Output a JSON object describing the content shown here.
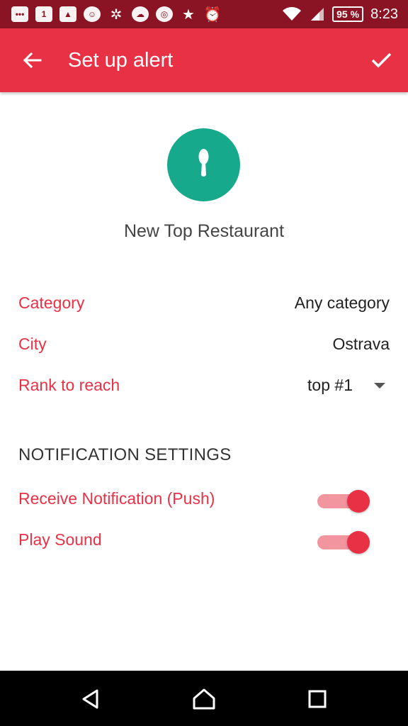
{
  "status_bar": {
    "notification_icons": [
      "messages-icon",
      "calendar-icon",
      "gallery-icon",
      "app-icon",
      "butterfly-icon",
      "weather-icon",
      "app2-icon",
      "star-icon",
      "alarm-icon"
    ],
    "calendar_number": "1",
    "battery": "95 %",
    "time": "8:23"
  },
  "app_bar": {
    "title": "Set up alert"
  },
  "alert": {
    "name": "New Top Restaurant",
    "badge_color": "#16a98c",
    "icon": "spoon-icon"
  },
  "fields": {
    "category": {
      "label": "Category",
      "value": "Any category"
    },
    "city": {
      "label": "City",
      "value": "Ostrava"
    },
    "rank": {
      "label": "Rank to reach",
      "value": "top #1"
    }
  },
  "notification_settings": {
    "title": "NOTIFICATION SETTINGS",
    "push": {
      "label": "Receive Notification (Push)",
      "enabled": true
    },
    "sound": {
      "label": "Play Sound",
      "enabled": true
    }
  },
  "colors": {
    "accent": "#e93146",
    "status_bar": "#8a1424",
    "toggle_track": "#f2959f"
  }
}
